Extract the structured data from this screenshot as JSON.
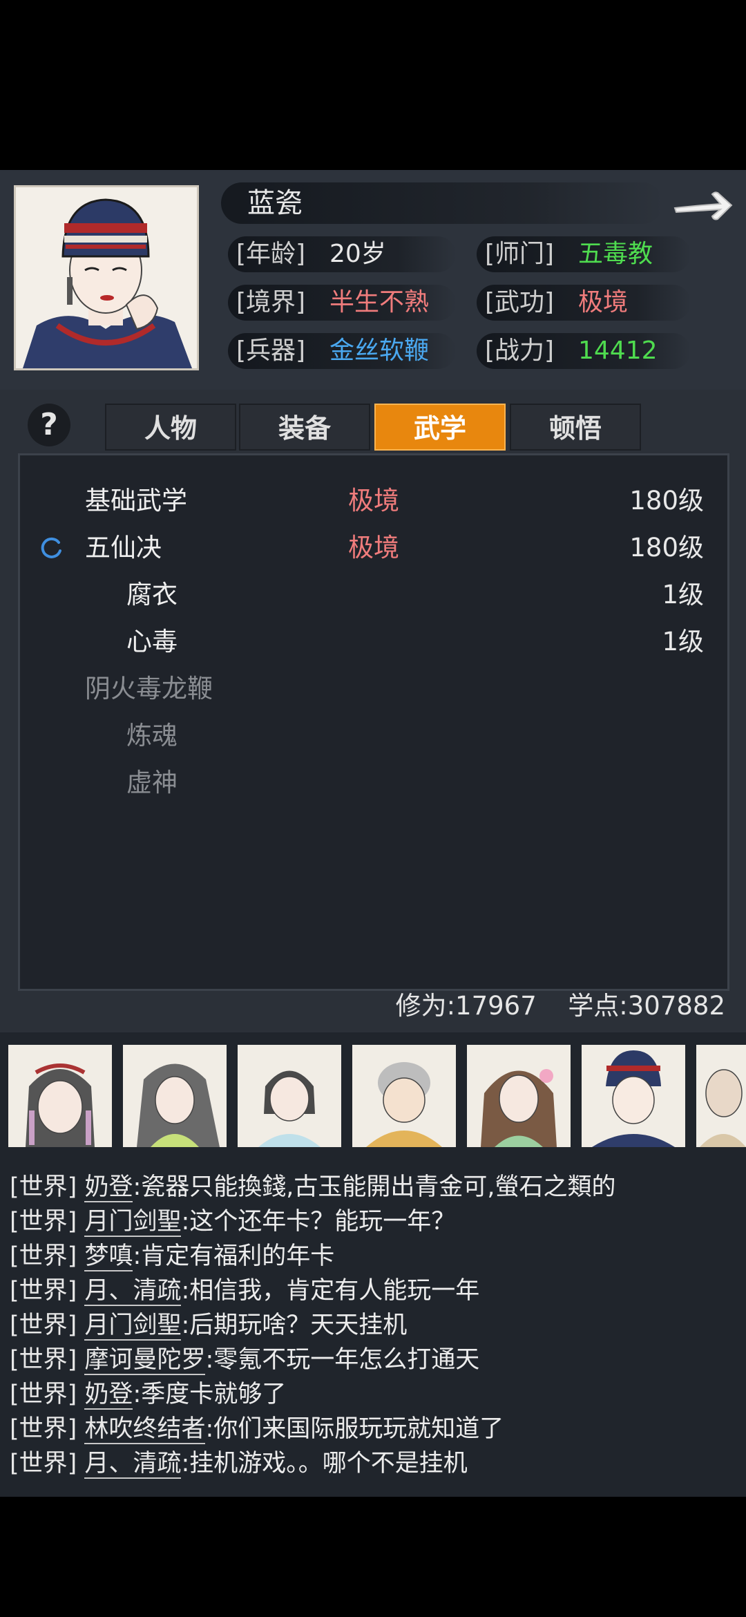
{
  "character": {
    "name": "蓝瓷",
    "stats": [
      {
        "label": "[年龄]",
        "value": "20岁",
        "color": "#e8e8e8"
      },
      {
        "label": "[师门]",
        "value": "五毒教",
        "color": "#4fdc4f"
      },
      {
        "label": "[境界]",
        "value": "半生不熟",
        "color": "#f07c7c"
      },
      {
        "label": "[武功]",
        "value": "极境",
        "color": "#f07c7c"
      },
      {
        "label": "[兵器]",
        "value": "金丝软鞭",
        "color": "#4aa8f0"
      },
      {
        "label": "[战力]",
        "value": "14412",
        "color": "#4fdc4f"
      }
    ]
  },
  "help": {
    "label": "?"
  },
  "tabs": [
    {
      "label": "人物",
      "active": false
    },
    {
      "label": "装备",
      "active": false
    },
    {
      "label": "武学",
      "active": true
    },
    {
      "label": "顿悟",
      "active": false
    }
  ],
  "skills": [
    {
      "name": "基础武学",
      "realm": "极境",
      "level": "180级",
      "indent": 0,
      "learned": true,
      "training": false
    },
    {
      "name": "五仙决",
      "realm": "极境",
      "level": "180级",
      "indent": 0,
      "learned": true,
      "training": true
    },
    {
      "name": "腐衣",
      "realm": "",
      "level": "1级",
      "indent": 1,
      "learned": true,
      "training": false
    },
    {
      "name": "心毒",
      "realm": "",
      "level": "1级",
      "indent": 1,
      "learned": true,
      "training": false
    },
    {
      "name": "阴火毒龙鞭",
      "realm": "",
      "level": "",
      "indent": 0,
      "learned": false,
      "training": false
    },
    {
      "name": "炼魂",
      "realm": "",
      "level": "",
      "indent": 1,
      "learned": false,
      "training": false
    },
    {
      "name": "虚神",
      "realm": "",
      "level": "",
      "indent": 1,
      "learned": false,
      "training": false
    }
  ],
  "footer": {
    "cultivation": "修为:17967",
    "learning_points": "学点:307882"
  },
  "chat": [
    {
      "channel": "[世界]",
      "user": "奶登",
      "text": ":瓷器只能換錢,古玉能開出青金可,螢石之類的"
    },
    {
      "channel": "[世界]",
      "user": "月门剑聖",
      "text": ":这个还年卡？能玩一年？"
    },
    {
      "channel": "[世界]",
      "user": "梦嗔",
      "text": ":肯定有福利的年卡"
    },
    {
      "channel": "[世界]",
      "user": "月、清疏",
      "text": ":相信我，肯定有人能玩一年"
    },
    {
      "channel": "[世界]",
      "user": "月门剑聖",
      "text": ":后期玩啥？天天挂机"
    },
    {
      "channel": "[世界]",
      "user": "摩诃曼陀罗",
      "text": ":零氪不玩一年怎么打通天"
    },
    {
      "channel": "[世界]",
      "user": "奶登",
      "text": ":季度卡就够了"
    },
    {
      "channel": "[世界]",
      "user": "林吹终结者",
      "text": ":你们来国际服玩玩就知道了"
    },
    {
      "channel": "[世界]",
      "user": "月、清疏",
      "text": ":挂机游戏。。哪个不是挂机"
    }
  ]
}
